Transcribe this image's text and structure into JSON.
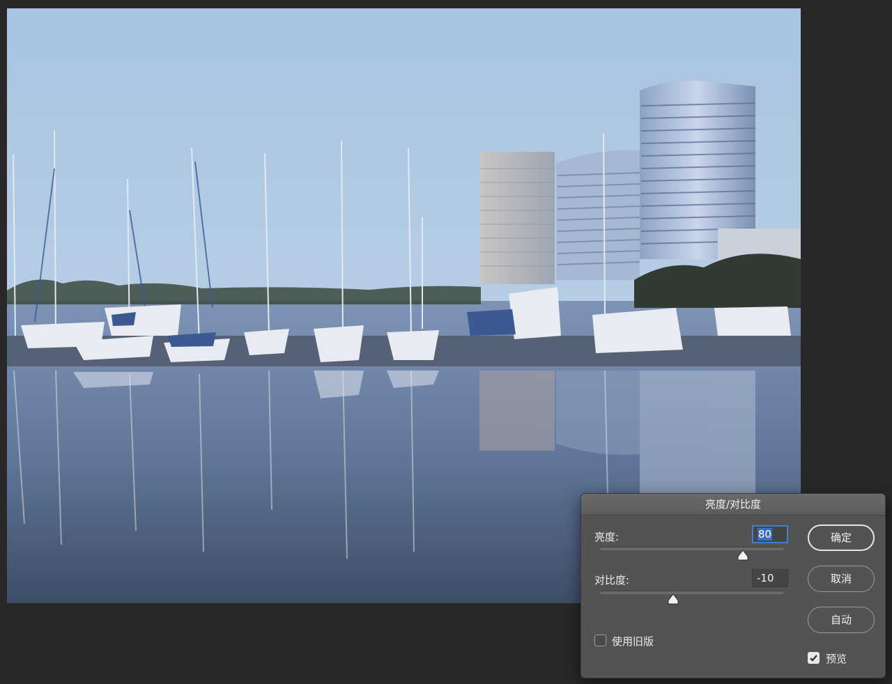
{
  "dialog": {
    "title": "亮度/对比度",
    "brightness": {
      "label": "亮度:",
      "value": "80",
      "slider_fraction": 0.78
    },
    "contrast": {
      "label": "对比度:",
      "value": "-10",
      "slider_fraction": 0.4
    },
    "buttons": {
      "ok": "确定",
      "cancel": "取消",
      "auto": "自动"
    },
    "use_legacy": {
      "label": "使用旧版",
      "checked": false
    },
    "preview": {
      "label": "预览",
      "checked": true
    }
  },
  "image": {
    "subject-icon": "marina-photo"
  },
  "colors": {
    "dialog_bg": "#535353",
    "focus_blue": "#3f7fd6",
    "workspace_bg": "#282828"
  }
}
